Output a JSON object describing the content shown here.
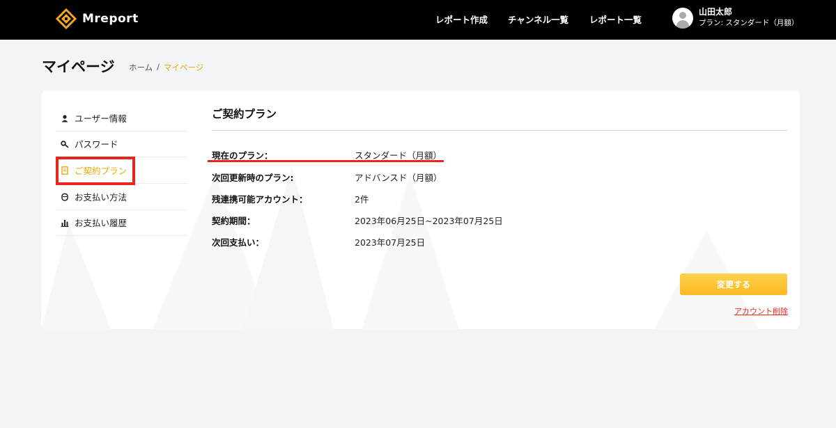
{
  "header": {
    "logo_text": "Mreport",
    "nav": [
      "レポート作成",
      "チャンネル一覧",
      "レポート一覧"
    ],
    "user_name": "山田太郎",
    "user_plan": "プラン: スタンダード（月額）"
  },
  "page": {
    "title": "マイページ",
    "breadcrumb": [
      "ホーム",
      "/",
      "マイページ"
    ]
  },
  "sidebar": {
    "items": [
      {
        "label": "ユーザー情報",
        "icon": "user-icon"
      },
      {
        "label": "パスワード",
        "icon": "key-icon"
      },
      {
        "label": "ご契約プラン",
        "icon": "document-icon",
        "active": true
      },
      {
        "label": "お支払い方法",
        "icon": "wallet-icon"
      },
      {
        "label": "お支払い履歴",
        "icon": "bar-chart-icon"
      }
    ]
  },
  "contract": {
    "title": "ご契約プラン",
    "rows": [
      {
        "label": "現在のプラン：",
        "value": "スタンダード（月額）"
      },
      {
        "label": "次回更新時のプラン:",
        "value": "アドバンスド（月額）"
      },
      {
        "label": "残連携可能アカウント：",
        "value": "2件"
      },
      {
        "label": "契約期間：",
        "value": "2023年06月25日~2023年07月25日"
      },
      {
        "label": "次回支払い：",
        "value": "2023年07月25日"
      }
    ],
    "change_button": "変更する",
    "delete_link": "アカウント削除"
  },
  "colors": {
    "accent": "#e9a800",
    "button": "#fcc93a",
    "highlight": "#e8271c",
    "header_bg": "#000000"
  }
}
